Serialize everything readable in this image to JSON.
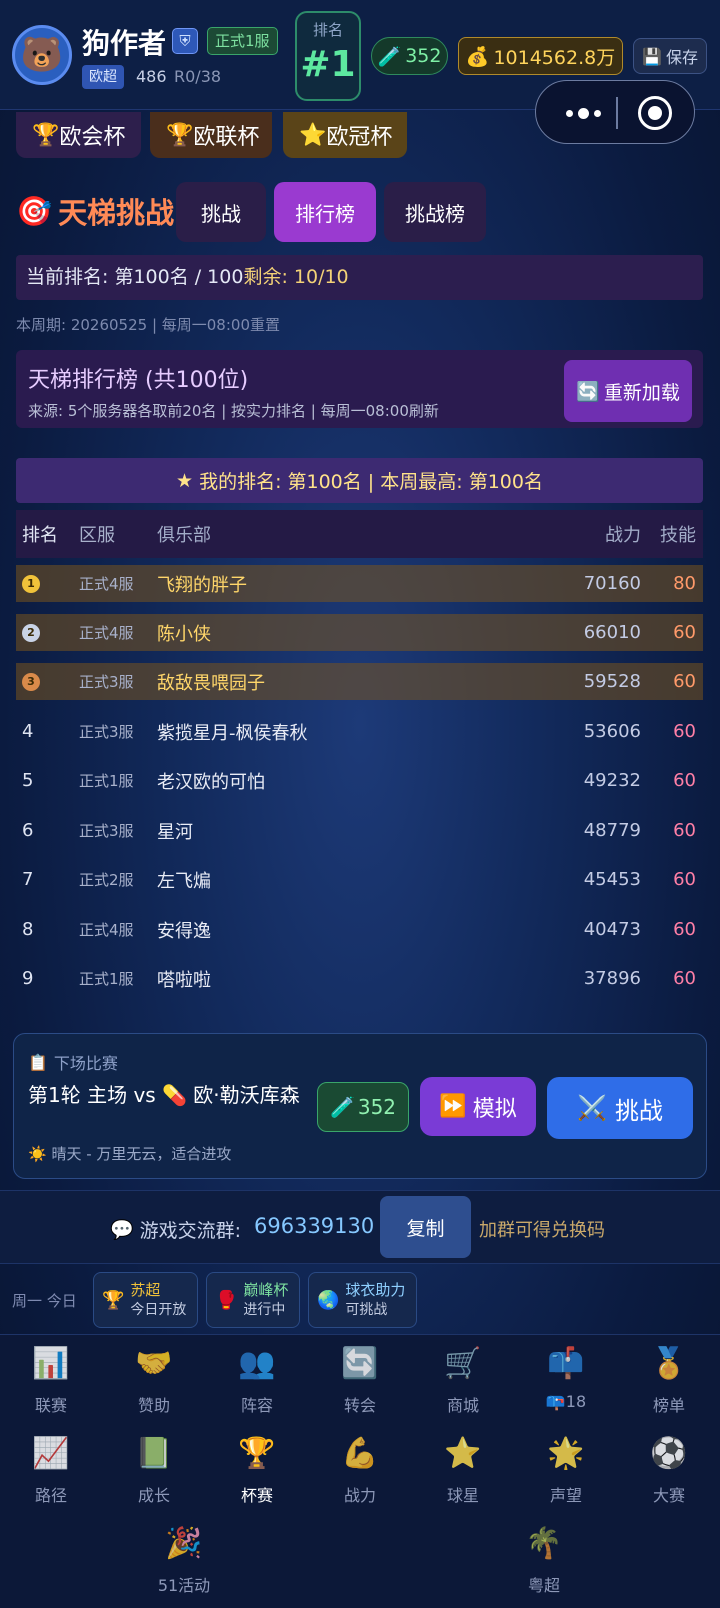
{
  "header": {
    "avatar": "bear-avatar",
    "player_name": "狗作者",
    "server": "正式1服",
    "league": "欧超",
    "league_points": "486",
    "league_record": "R0/38",
    "rank_label": "排名",
    "rank_value": "#1",
    "energy": "352",
    "coins": "1014562.8万",
    "save_label": "保存"
  },
  "cups": [
    {
      "label": "欧会杯",
      "icon": "trophy-icon"
    },
    {
      "label": "欧联杯",
      "icon": "trophy-icon"
    },
    {
      "label": "欧冠杯",
      "icon": "star-icon"
    }
  ],
  "ladder": {
    "title": "天梯挑战",
    "tabs": [
      "挑战",
      "排行榜",
      "挑战榜"
    ],
    "active_tab": "排行榜",
    "current_rank": "当前排名: 第100名 / 100",
    "remaining": "剩余: 10/10",
    "week_info": "本周期: 20260525 | 每周一08:00重置",
    "board_title": "天梯排行榜 (共100位)",
    "board_source": "来源: 5个服务器各取前20名 | 按实力排名 | 每周一08:00刷新",
    "reload_label": "重新加载",
    "my_rank": "我的排名: 第100名 | 本周最高: 第100名"
  },
  "table": {
    "headers": {
      "rank": "排名",
      "server": "区服",
      "club": "俱乐部",
      "power": "战力",
      "skill": "技能"
    },
    "rows": [
      {
        "rank": "1",
        "server": "正式4服",
        "club": "飞翔的胖子",
        "power": "70160",
        "skill": "80"
      },
      {
        "rank": "2",
        "server": "正式4服",
        "club": "陈小侠",
        "power": "66010",
        "skill": "60"
      },
      {
        "rank": "3",
        "server": "正式3服",
        "club": "敌敌畏喂园子",
        "power": "59528",
        "skill": "60"
      },
      {
        "rank": "4",
        "server": "正式3服",
        "club": "紫揽星月-枫侯春秋",
        "power": "53606",
        "skill": "60"
      },
      {
        "rank": "5",
        "server": "正式1服",
        "club": "老汉欧的可怕",
        "power": "49232",
        "skill": "60"
      },
      {
        "rank": "6",
        "server": "正式3服",
        "club": "星河",
        "power": "48779",
        "skill": "60"
      },
      {
        "rank": "7",
        "server": "正式2服",
        "club": "左飞煸",
        "power": "45453",
        "skill": "60"
      },
      {
        "rank": "8",
        "server": "正式4服",
        "club": "安得逸",
        "power": "40473",
        "skill": "60"
      },
      {
        "rank": "9",
        "server": "正式1服",
        "club": "嗒啦啦",
        "power": "37896",
        "skill": "60"
      }
    ]
  },
  "next_match": {
    "label": "下场比赛",
    "desc": "第1轮 主场 vs 💊 欧·勒沃库森",
    "weather": "晴天 - 万里无云，适合进攻",
    "energy": "352",
    "simulate_label": "模拟",
    "challenge_label": "挑战"
  },
  "community": {
    "label": "游戏交流群:",
    "number": "696339130",
    "copy_label": "复制",
    "note": "加群可得兑换码"
  },
  "events": {
    "day_label": "周一 今日",
    "items": [
      {
        "title": "苏超",
        "status": "今日开放",
        "icon": "trophy-icon",
        "color": "#f0c23a"
      },
      {
        "title": "巅峰杯",
        "status": "进行中",
        "icon": "boxing-glove-icon",
        "color": "#7de0a0"
      },
      {
        "title": "球衣助力",
        "status": "可挑战",
        "icon": "globe-icon",
        "color": "#8fd0ff"
      }
    ]
  },
  "nav": {
    "active": "杯赛",
    "items": [
      {
        "label": "联赛",
        "icon": "📊"
      },
      {
        "label": "赞助",
        "icon": "🤝"
      },
      {
        "label": "阵容",
        "icon": "👥"
      },
      {
        "label": "转会",
        "icon": "🔄"
      },
      {
        "label": "商城",
        "icon": "🛒"
      },
      {
        "label": "📪18",
        "icon": "📫"
      },
      {
        "label": "榜单",
        "icon": "🏅"
      },
      {
        "label": "路径",
        "icon": "📈"
      },
      {
        "label": "成长",
        "icon": "📗"
      },
      {
        "label": "杯赛",
        "icon": "🏆"
      },
      {
        "label": "战力",
        "icon": "💪"
      },
      {
        "label": "球星",
        "icon": "⭐"
      },
      {
        "label": "声望",
        "icon": "🌟"
      },
      {
        "label": "大赛",
        "icon": "⚽"
      },
      {
        "label": "51活动",
        "icon": "🎉"
      },
      {
        "label": "粤超",
        "icon": "🌴"
      }
    ]
  },
  "colors": {
    "accent_purple": "#9a3ad0",
    "accent_blue": "#2f6de8",
    "gold": "#ffd45c",
    "green": "#5de8a0"
  }
}
